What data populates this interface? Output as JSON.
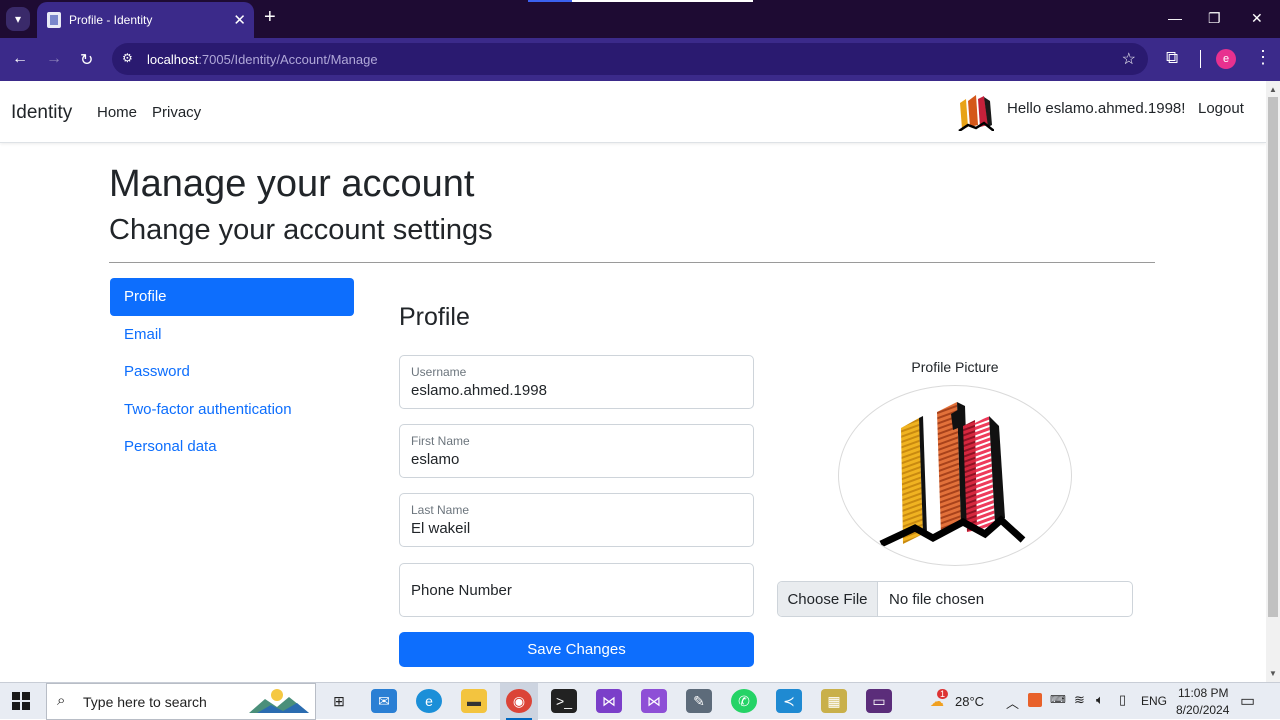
{
  "browser": {
    "tab_title": "Profile - Identity",
    "url_host": "localhost",
    "url_path": ":7005/Identity/Account/Manage",
    "profile_initial": "e"
  },
  "navbar": {
    "brand": "Identity",
    "links": [
      "Home",
      "Privacy"
    ],
    "greeting": "Hello eslamo.ahmed.1998!",
    "logout": "Logout"
  },
  "header": {
    "title": "Manage your account",
    "subtitle": "Change your account settings"
  },
  "sidenav": {
    "items": [
      "Profile",
      "Email",
      "Password",
      "Two-factor authentication",
      "Personal data"
    ],
    "active_index": 0
  },
  "form": {
    "heading": "Profile",
    "username": {
      "label": "Username",
      "value": "eslamo.ahmed.1998"
    },
    "first_name": {
      "label": "First Name",
      "value": "eslamo"
    },
    "last_name": {
      "label": "Last Name",
      "value": "El wakeil"
    },
    "phone": {
      "label": "Phone Number",
      "value": ""
    },
    "save_label": "Save Changes"
  },
  "picture": {
    "label": "Profile Picture",
    "choose_label": "Choose File",
    "file_status": "No file chosen"
  },
  "taskbar": {
    "search_placeholder": "Type here to search",
    "temperature": "28°C",
    "language": "ENG",
    "time": "11:08 PM",
    "date": "8/20/2024",
    "weather_badge": "1"
  },
  "colors": {
    "accent": "#0d6efd",
    "chrome_dark": "#1e0b33",
    "chrome_toolbar": "#3b2a8a"
  }
}
